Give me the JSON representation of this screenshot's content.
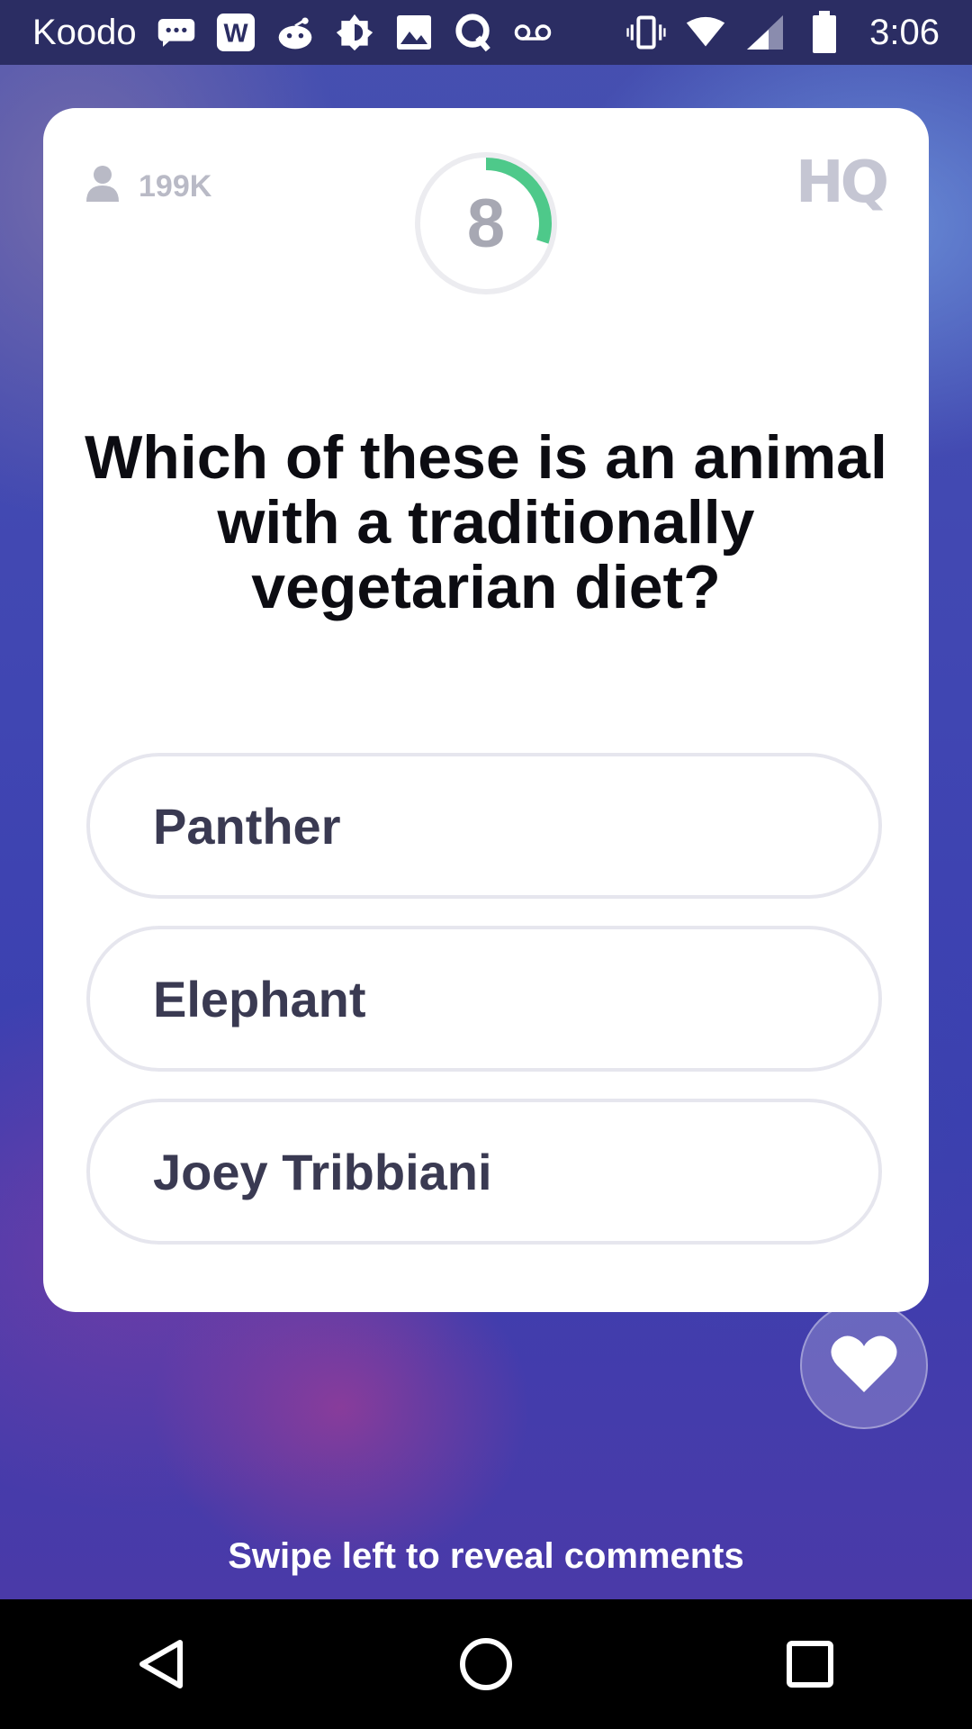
{
  "status_bar": {
    "carrier": "Koodo",
    "time": "3:06",
    "icons": [
      "messages-icon",
      "w-app-icon",
      "reddit-icon",
      "brightness-icon",
      "image-icon",
      "q-app-icon",
      "voicemail-icon",
      "vibrate-icon",
      "wifi-icon",
      "signal-icon",
      "battery-icon"
    ]
  },
  "card": {
    "player_count": "199K",
    "logo": "HQ",
    "timer": {
      "value": "8",
      "progress": 0.3
    },
    "question": "Which of these is an animal with a traditionally vegetarian diet?",
    "answers": [
      "Panther",
      "Elephant",
      "Joey Tribbiani"
    ]
  },
  "hint": "Swipe left to reveal comments",
  "colors": {
    "timer_accent": "#4ec98a",
    "status_bar": "#2b2d63",
    "card": "#ffffff"
  }
}
